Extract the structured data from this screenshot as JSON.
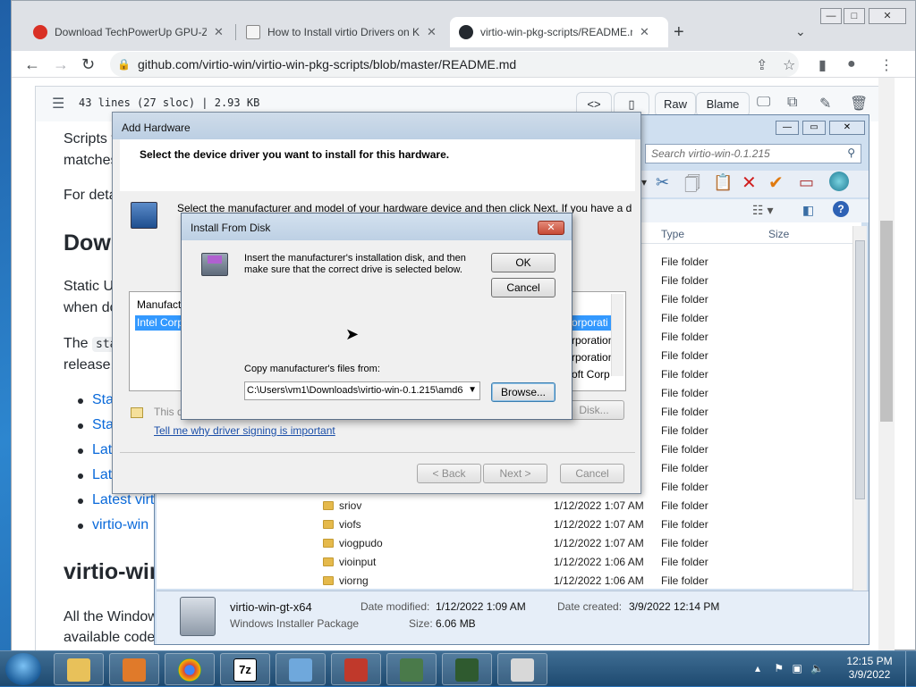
{
  "browser": {
    "tabs": [
      {
        "title": "Download TechPowerUp GPU-Z",
        "close": "✕"
      },
      {
        "title": "How to Install virtio Drivers on K",
        "close": "✕"
      },
      {
        "title": "virtio-win-pkg-scripts/README.m",
        "close": "✕"
      }
    ],
    "new_tab": "+",
    "url": "github.com/virtio-win/virtio-win-pkg-scripts/blob/master/README.md",
    "window_controls": {
      "minimize": "—",
      "maximize": "□",
      "close": "✕"
    }
  },
  "github": {
    "file_info": "43 lines (27 sloc)  |  2.93 KB",
    "buttons": {
      "raw": "Raw",
      "blame": "Blame"
    },
    "content": {
      "line1": "Scripts f",
      "line2": "matches",
      "line3": "For deta",
      "heading1": "Dowr",
      "line4": "Static U",
      "line5": "when do",
      "line6_prefix": "The ",
      "line6_code": "sta",
      "line7": "release.",
      "links": [
        "Sta",
        "Sta",
        "Lat",
        "Lat",
        "Latest virt",
        "virtio-win"
      ],
      "heading2": "virtio-win",
      "line8": "All the Window",
      "line9": "available code"
    }
  },
  "explorer": {
    "search_placeholder": "Search virtio-win-0.1.215",
    "columns": {
      "type": "Type",
      "size": "Size"
    },
    "type_only_rows": [
      "File folder",
      "File folder",
      "File folder",
      "File folder",
      "File folder",
      "File folder",
      "File folder",
      "File folder",
      "File folder",
      "File folder",
      "File folder",
      "File folder",
      "File folder"
    ],
    "rows": [
      {
        "name": "sriov",
        "date": "1/12/2022 1:07 AM",
        "type": "File folder"
      },
      {
        "name": "viofs",
        "date": "1/12/2022 1:07 AM",
        "type": "File folder"
      },
      {
        "name": "viogpudo",
        "date": "1/12/2022 1:07 AM",
        "type": "File folder"
      },
      {
        "name": "vioinput",
        "date": "1/12/2022 1:06 AM",
        "type": "File folder"
      },
      {
        "name": "viorng",
        "date": "1/12/2022 1:06 AM",
        "type": "File folder"
      }
    ],
    "details": {
      "name": "virtio-win-gt-x64",
      "kind": "Windows Installer Package",
      "modified_label": "Date modified:",
      "modified": "1/12/2022 1:09 AM",
      "size_label": "Size:",
      "size": "6.06 MB",
      "created_label": "Date created:",
      "created": "3/9/2022 12:14 PM"
    }
  },
  "wizard": {
    "title": "Add Hardware",
    "header": "Select the device driver you want to install for this hardware.",
    "instruction": "Select the manufacturer and model of your hardware device and then click Next. If you have a d",
    "manufacturer_header": "Manufact",
    "manufacturer_selected": "Intel Corp",
    "model_items": [
      "orporati",
      "rporation",
      "rporation",
      "oft Corp"
    ],
    "signed_text": "This d",
    "have_disk": "Disk...",
    "signing_link": "Tell me why driver signing is important",
    "buttons": {
      "back": "< Back",
      "next": "Next >",
      "cancel": "Cancel"
    }
  },
  "install_from_disk": {
    "title": "Install From Disk",
    "message": "Insert the manufacturer's installation disk, and then make sure that the correct drive is selected below.",
    "ok": "OK",
    "cancel": "Cancel",
    "copy_label": "Copy manufacturer's files from:",
    "path": "C:\\Users\\vm1\\Downloads\\virtio-win-0.1.215\\amd6",
    "browse": "Browse..."
  },
  "taskbar": {
    "time": "12:15 PM",
    "date": "3/9/2022"
  },
  "colors": {
    "link": "#0969da",
    "selection": "#3399ff",
    "taskbar": "#1e4a70"
  }
}
